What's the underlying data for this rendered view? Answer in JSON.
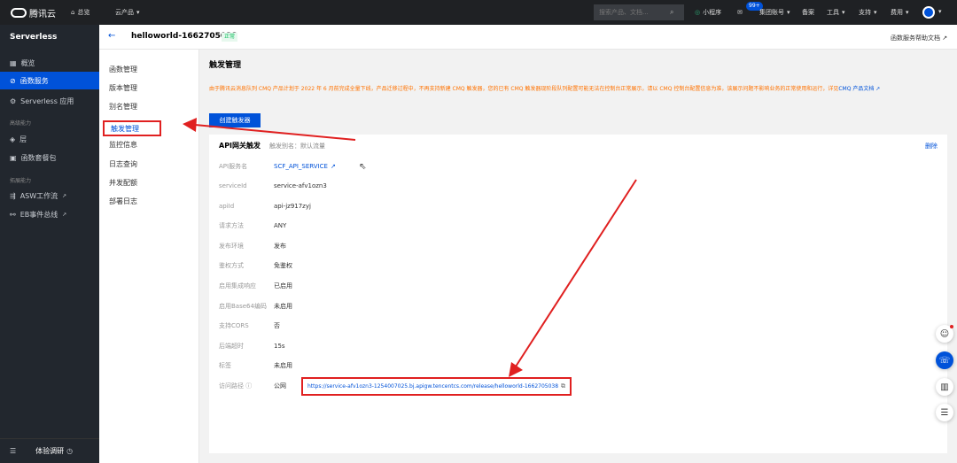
{
  "topbar": {
    "brand": "腾讯云",
    "home": "总览",
    "products": "云产品",
    "search_placeholder": "搜索产品、文档...",
    "mini_program": "小程序",
    "badge": "99+",
    "account": "集团账号",
    "filing": "备案",
    "tools": "工具",
    "support": "支持",
    "cost": "费用"
  },
  "sidebar": {
    "title": "Serverless",
    "items": [
      {
        "label": "概览"
      },
      {
        "label": "函数服务"
      },
      {
        "label": "Serverless 应用"
      }
    ],
    "section_advanced": "高级能力",
    "advanced": [
      {
        "label": "层"
      },
      {
        "label": "函数套餐包"
      }
    ],
    "section_ext": "拓展能力",
    "ext": [
      {
        "label": "ASW工作流"
      },
      {
        "label": "EB事件总线"
      }
    ],
    "footer": "体验调研"
  },
  "header": {
    "title": "helloworld-1662705038",
    "status": "正常",
    "help": "函数服务帮助文档"
  },
  "nav2": {
    "items": [
      "函数管理",
      "版本管理",
      "别名管理",
      "触发管理",
      "监控信息",
      "日志查询",
      "并发配额",
      "部署日志"
    ]
  },
  "main": {
    "title": "触发管理",
    "notice": "由于腾讯云消息队列 CMQ 产品计划于 2022 年 6 月前完成全量下线，产品迁移过程中，不再支持新建 CMQ 触发器，您的已有 CMQ 触发器现阶段队列配置可能无法在控制台正常展示，请以 CMQ 控制台配置信息为准，该展示问题不影响业务的正常使用和运行，详见",
    "notice_link": "CMQ 产品文档",
    "create_btn": "创建触发器",
    "card": {
      "title": "API网关触发",
      "alias": "触发别名：默认流量",
      "delete": "删除",
      "rows": [
        {
          "label": "API服务名",
          "value": "SCF_API_SERVICE"
        },
        {
          "label": "serviceId",
          "value": "service-afv1ozn3"
        },
        {
          "label": "apiId",
          "value": "api-jz917zyj"
        },
        {
          "label": "请求方法",
          "value": "ANY"
        },
        {
          "label": "发布环境",
          "value": "发布"
        },
        {
          "label": "鉴权方式",
          "value": "免鉴权"
        },
        {
          "label": "启用集成响应",
          "value": "已启用"
        },
        {
          "label": "启用Base64编码",
          "value": "未启用"
        },
        {
          "label": "支持CORS",
          "value": "否"
        },
        {
          "label": "后端超时",
          "value": "15s"
        },
        {
          "label": "标签",
          "value": "未启用"
        },
        {
          "label": "访问路径",
          "value": "公网"
        }
      ],
      "url": "https://service-afv1ozn3-1254007025.bj.apigw.tencentcs.com/release/helloworld-1662705038"
    }
  }
}
